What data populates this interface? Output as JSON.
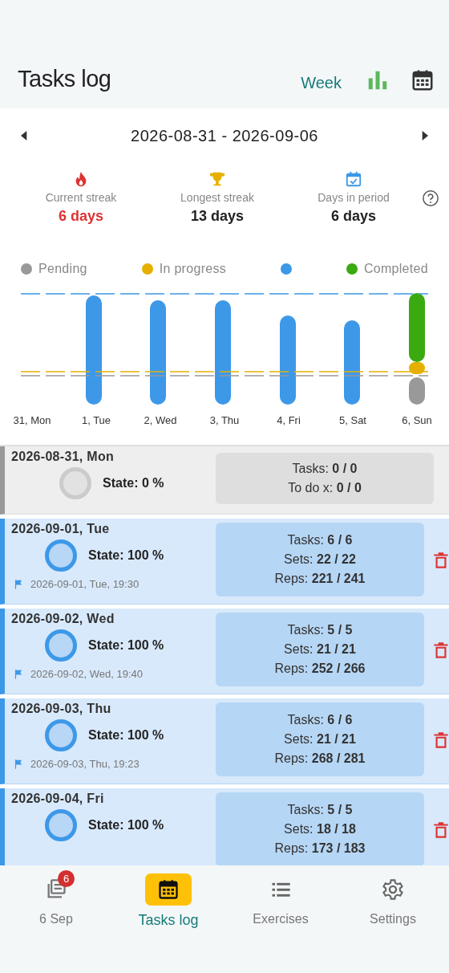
{
  "header": {
    "title": "Tasks log",
    "period": "Week"
  },
  "range": {
    "label": "2026-08-31 - 2026-09-06"
  },
  "stats": [
    {
      "kind": "current",
      "label": "Current streak",
      "value": "6 days"
    },
    {
      "kind": "longest",
      "label": "Longest streak",
      "value": "13 days"
    },
    {
      "kind": "days",
      "label": "Days in period",
      "value": "6 days"
    }
  ],
  "legend": [
    {
      "label": "Pending",
      "color": "#999999"
    },
    {
      "label": "In progress",
      "color": "#e6b000"
    },
    {
      "color": "#3d98e8"
    },
    {
      "label": "Completed",
      "color": "#3aaa10"
    }
  ],
  "chart_days": [
    {
      "kind": "empty",
      "label": "31, Mon"
    },
    {
      "kind": "single",
      "label": "1, Tue",
      "level": 0.97
    },
    {
      "kind": "single",
      "label": "2, Wed",
      "level": 0.93
    },
    {
      "kind": "single",
      "label": "3, Thu",
      "level": 0.93
    },
    {
      "kind": "single",
      "label": "4, Fri",
      "level": 0.79
    },
    {
      "kind": "single",
      "label": "5, Sat",
      "level": 0.75
    },
    {
      "kind": "stacked",
      "label": "6, Sun",
      "segments": [
        {
          "kind": "completed",
          "level": 0.62
        },
        {
          "kind": "in_progress"
        },
        {
          "kind": "pending",
          "level": 0.24
        }
      ]
    }
  ],
  "cards": [
    {
      "kind": "empty",
      "date": "2026-08-31, Mon",
      "state": "State: 0 %",
      "lines": [
        {
          "label": "Tasks:",
          "value": "0 / 0"
        },
        {
          "label": "To do x:",
          "value": "0 / 0"
        }
      ]
    },
    {
      "kind": "done",
      "date": "2026-09-01, Tue",
      "state": "State: 100 %",
      "finished": "2026-09-01, Tue, 19:30",
      "lines": [
        {
          "label": "Tasks:",
          "value": "6 / 6"
        },
        {
          "label": "Sets:",
          "value": "22 / 22"
        },
        {
          "label": "Reps:",
          "value": "221 / 241"
        }
      ]
    },
    {
      "kind": "done",
      "date": "2026-09-02, Wed",
      "state": "State: 100 %",
      "finished": "2026-09-02, Wed, 19:40",
      "lines": [
        {
          "label": "Tasks:",
          "value": "5 / 5"
        },
        {
          "label": "Sets:",
          "value": "21 / 21"
        },
        {
          "label": "Reps:",
          "value": "252 / 266"
        }
      ]
    },
    {
      "kind": "done",
      "date": "2026-09-03, Thu",
      "state": "State: 100 %",
      "finished": "2026-09-03, Thu, 19:23",
      "lines": [
        {
          "label": "Tasks:",
          "value": "6 / 6"
        },
        {
          "label": "Sets:",
          "value": "21 / 21"
        },
        {
          "label": "Reps:",
          "value": "268 / 281"
        }
      ]
    },
    {
      "kind": "done",
      "date": "2026-09-04, Fri",
      "state": "State: 100 %",
      "lines": [
        {
          "label": "Tasks:",
          "value": "5 / 5"
        },
        {
          "label": "Sets:",
          "value": "18 / 18"
        },
        {
          "label": "Reps:",
          "value": "173 / 183"
        }
      ]
    }
  ],
  "nav": [
    {
      "kind": "today",
      "label": "6 Sep",
      "badge": "6",
      "selected": false
    },
    {
      "kind": "log",
      "label": "Tasks log",
      "selected": true
    },
    {
      "kind": "exercises",
      "label": "Exercises",
      "selected": false
    },
    {
      "kind": "settings",
      "label": "Settings",
      "selected": false
    }
  ]
}
